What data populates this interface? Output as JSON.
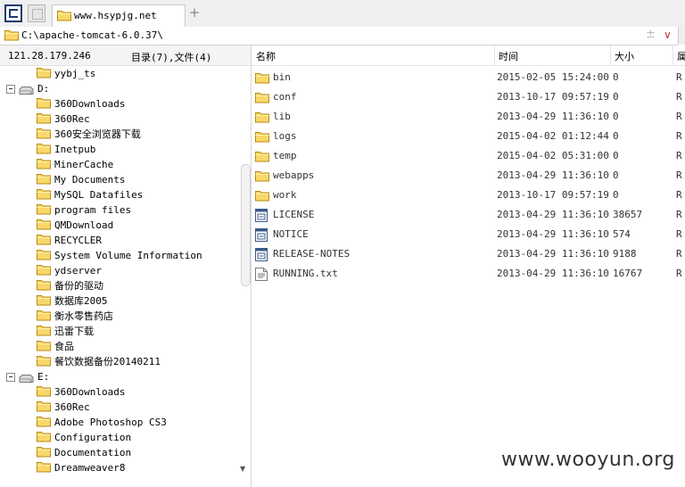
{
  "tab": {
    "title": "www.hsypjg.net"
  },
  "address": {
    "path": "C:\\apache-tomcat-6.0.37\\"
  },
  "left_header": {
    "ip": "121.28.179.246",
    "counts": "目录(7),文件(4)"
  },
  "tree": [
    {
      "label": "yybj_ts",
      "kind": "folder",
      "level": 2
    },
    {
      "label": "D:",
      "kind": "drive",
      "level": 1
    },
    {
      "label": "360Downloads",
      "kind": "folder",
      "level": 2
    },
    {
      "label": "360Rec",
      "kind": "folder",
      "level": 2
    },
    {
      "label": "360安全浏览器下载",
      "kind": "folder",
      "level": 2
    },
    {
      "label": "Inetpub",
      "kind": "folder",
      "level": 2
    },
    {
      "label": "MinerCache",
      "kind": "folder",
      "level": 2
    },
    {
      "label": "My Documents",
      "kind": "folder",
      "level": 2
    },
    {
      "label": "MySQL Datafiles",
      "kind": "folder",
      "level": 2
    },
    {
      "label": "program files",
      "kind": "folder",
      "level": 2
    },
    {
      "label": "QMDownload",
      "kind": "folder",
      "level": 2
    },
    {
      "label": "RECYCLER",
      "kind": "folder",
      "level": 2
    },
    {
      "label": "System Volume Information",
      "kind": "folder",
      "level": 2
    },
    {
      "label": "ydserver",
      "kind": "folder",
      "level": 2
    },
    {
      "label": "备份的驱动",
      "kind": "folder",
      "level": 2
    },
    {
      "label": "数据库2005",
      "kind": "folder",
      "level": 2
    },
    {
      "label": "衡水零售药店",
      "kind": "folder",
      "level": 2
    },
    {
      "label": "迅雷下载",
      "kind": "folder",
      "level": 2
    },
    {
      "label": "食品",
      "kind": "folder",
      "level": 2
    },
    {
      "label": "餐饮数据备份20140211",
      "kind": "folder",
      "level": 2
    },
    {
      "label": "E:",
      "kind": "drive",
      "level": 1
    },
    {
      "label": "360Downloads",
      "kind": "folder",
      "level": 2
    },
    {
      "label": "360Rec",
      "kind": "folder",
      "level": 2
    },
    {
      "label": "Adobe Photoshop CS3",
      "kind": "folder",
      "level": 2
    },
    {
      "label": "Configuration",
      "kind": "folder",
      "level": 2
    },
    {
      "label": "Documentation",
      "kind": "folder",
      "level": 2
    },
    {
      "label": "Dreamweaver8",
      "kind": "folder",
      "level": 2
    }
  ],
  "columns": {
    "name": "名称",
    "time": "时间",
    "size": "大小",
    "attr": "属"
  },
  "files": [
    {
      "name": "bin",
      "time": "2015-02-05 15:24:00",
      "size": "0",
      "attr": "R",
      "icon": "folder-icon"
    },
    {
      "name": "conf",
      "time": "2013-10-17 09:57:19",
      "size": "0",
      "attr": "R",
      "icon": "folder-icon"
    },
    {
      "name": "lib",
      "time": "2013-04-29 11:36:10",
      "size": "0",
      "attr": "R",
      "icon": "folder-icon"
    },
    {
      "name": "logs",
      "time": "2015-04-02 01:12:44",
      "size": "0",
      "attr": "R",
      "icon": "folder-icon"
    },
    {
      "name": "temp",
      "time": "2015-04-02 05:31:00",
      "size": "0",
      "attr": "R",
      "icon": "folder-icon"
    },
    {
      "name": "webapps",
      "time": "2013-04-29 11:36:10",
      "size": "0",
      "attr": "R",
      "icon": "folder-icon"
    },
    {
      "name": "work",
      "time": "2013-10-17 09:57:19",
      "size": "0",
      "attr": "R",
      "icon": "folder-icon"
    },
    {
      "name": "LICENSE",
      "time": "2013-04-29 11:36:10",
      "size": "38657",
      "attr": "R",
      "icon": "file-icon"
    },
    {
      "name": "NOTICE",
      "time": "2013-04-29 11:36:10",
      "size": "574",
      "attr": "R",
      "icon": "file-icon"
    },
    {
      "name": "RELEASE-NOTES",
      "time": "2013-04-29 11:36:10",
      "size": "9188",
      "attr": "R",
      "icon": "file-icon"
    },
    {
      "name": "RUNNING.txt",
      "time": "2013-04-29 11:36:10",
      "size": "16767",
      "attr": "R",
      "icon": "text-file-icon"
    }
  ],
  "watermark": "www.wooyun.org"
}
